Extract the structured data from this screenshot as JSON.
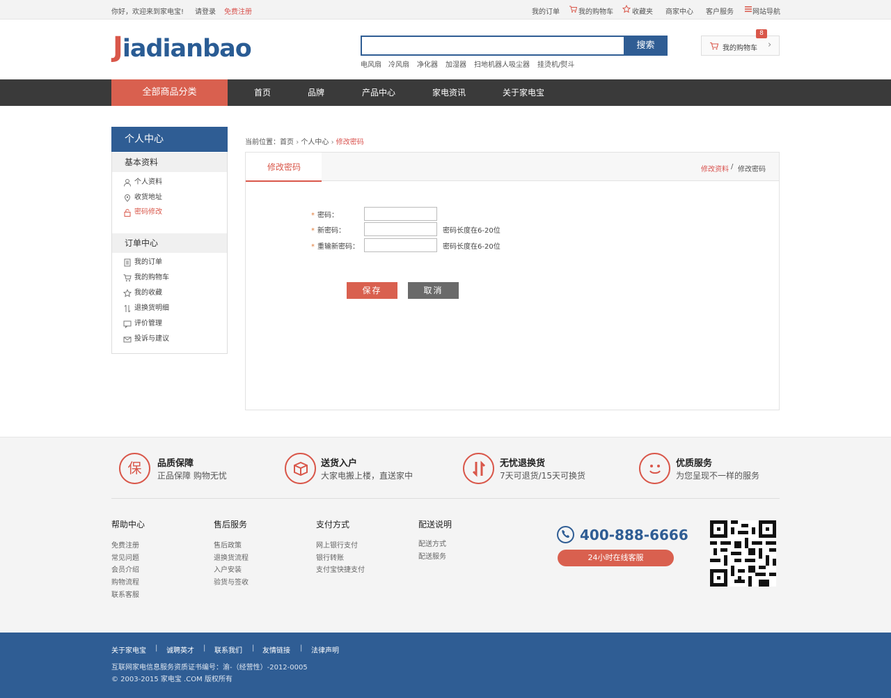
{
  "topbar": {
    "welcome": "你好，欢迎来到家电宝!",
    "login": "请登录",
    "register": "免费注册",
    "links": [
      "我的订单",
      "我的购物车",
      "收藏夹",
      "商家中心",
      "客户服务",
      "网站导航"
    ]
  },
  "header": {
    "logo_first": "J",
    "logo_rest": "iadianbao",
    "search_placeholder": "",
    "search_button": "搜索",
    "hot_keywords": [
      "电风扇",
      "冷风扇",
      "净化器",
      "加湿器",
      "扫地机器人吸尘器",
      "挂烫机/熨斗"
    ],
    "cart_label": "我的购物车",
    "cart_count": "8"
  },
  "nav": {
    "all": "全部商品分类",
    "items": [
      "首页",
      "品牌",
      "产品中心",
      "家电资讯",
      "关于家电宝"
    ]
  },
  "sidebar": {
    "title": "个人中心",
    "sections": [
      {
        "title": "基本资料",
        "items": [
          "个人资料",
          "收货地址",
          "密码修改"
        ]
      },
      {
        "title": "订单中心",
        "items": [
          "我的订单",
          "我的购物车",
          "我的收藏",
          "退换货明细",
          "评价管理",
          "投诉与建议"
        ]
      }
    ],
    "active_item": "密码修改"
  },
  "breadcrumb": {
    "prefix": "当前位置：",
    "items": [
      "首页",
      "个人中心",
      "修改密码"
    ]
  },
  "panel": {
    "tab": "修改密码",
    "right_links": [
      "修改资料",
      "修改密码"
    ],
    "right_sep": "/",
    "fields": [
      {
        "label": "密码：",
        "value": "",
        "hint": ""
      },
      {
        "label": "新密码：",
        "value": "",
        "hint": "密码长度在6-20位"
      },
      {
        "label": "重输新密码：",
        "value": "",
        "hint": "密码长度在6-20位"
      }
    ],
    "save": "保存",
    "cancel": "取消"
  },
  "features": [
    {
      "icon_char": "保",
      "icon": "shield-icon",
      "title": "品质保障",
      "sub": "正品保障 购物无忧"
    },
    {
      "icon_char": "▣",
      "icon": "box-icon",
      "title": "送货入户",
      "sub": "大家电搬上楼，直送家中"
    },
    {
      "icon_char": "⇅",
      "icon": "return-icon",
      "title": "无忧退换货",
      "sub": "7天可退货/15天可换货"
    },
    {
      "icon_char": "☺",
      "icon": "smile-icon",
      "title": "优质服务",
      "sub": "为您呈现不一样的服务"
    }
  ],
  "footer_links": [
    {
      "title": "帮助中心",
      "items": [
        "免费注册",
        "常见问题",
        "会员介绍",
        "购物流程",
        "联系客服"
      ]
    },
    {
      "title": "售后服务",
      "items": [
        "售后政策",
        "退换货流程",
        "入户安装",
        "验货与签收"
      ]
    },
    {
      "title": "支付方式",
      "items": [
        "网上银行支付",
        "银行转账",
        "支付宝快捷支付"
      ]
    },
    {
      "title": "配送说明",
      "items": [
        "配送方式",
        "配送服务"
      ]
    }
  ],
  "contact": {
    "phone": "400-888-6666",
    "online": "24小时在线客服"
  },
  "bottom": {
    "links": [
      "关于家电宝",
      "诚聘英才",
      "联系我们",
      "友情链接",
      "法律声明"
    ],
    "license": "互联网家电信息服务资质证书编号：渝-（经营性）-2012-0005",
    "copyright": "© 2003-2015 家电宝 .COM 版权所有"
  },
  "colors": {
    "brand_blue": "#2f5d94",
    "accent_red": "#d9574a",
    "nav_dark": "#3a3a3a"
  }
}
